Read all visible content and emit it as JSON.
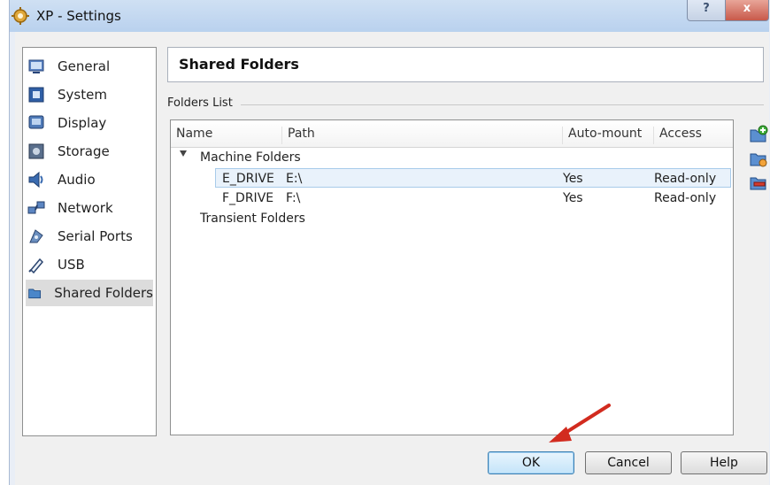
{
  "window": {
    "title": "XP - Settings",
    "help_glyph": "?",
    "close_glyph": "x"
  },
  "sidebar": {
    "items": [
      {
        "label": "General",
        "icon": "general-icon"
      },
      {
        "label": "System",
        "icon": "system-icon"
      },
      {
        "label": "Display",
        "icon": "display-icon"
      },
      {
        "label": "Storage",
        "icon": "storage-icon"
      },
      {
        "label": "Audio",
        "icon": "audio-icon"
      },
      {
        "label": "Network",
        "icon": "network-icon"
      },
      {
        "label": "Serial Ports",
        "icon": "serial-ports-icon"
      },
      {
        "label": "USB",
        "icon": "usb-icon"
      },
      {
        "label": "Shared Folders",
        "icon": "shared-folders-icon",
        "selected": true
      }
    ]
  },
  "page": {
    "title": "Shared Folders",
    "group_label": "Folders List"
  },
  "table": {
    "columns": [
      "Name",
      "Path",
      "Auto-mount",
      "Access"
    ],
    "machine_folders_label": "Machine Folders",
    "rows": [
      {
        "name": "E_DRIVE",
        "path": "E:\\",
        "auto_mount": "Yes",
        "access": "Read-only",
        "selected": true
      },
      {
        "name": "F_DRIVE",
        "path": "F:\\",
        "auto_mount": "Yes",
        "access": "Read-only"
      }
    ],
    "transient_folders_label": "Transient Folders"
  },
  "toolbar": {
    "icons": [
      "add-folder-icon",
      "edit-folder-icon",
      "remove-folder-icon"
    ]
  },
  "buttons": {
    "ok": "OK",
    "cancel": "Cancel",
    "help": "Help"
  },
  "colors": {
    "accent": "#3c7fb1",
    "arrow": "#d22b1f"
  }
}
